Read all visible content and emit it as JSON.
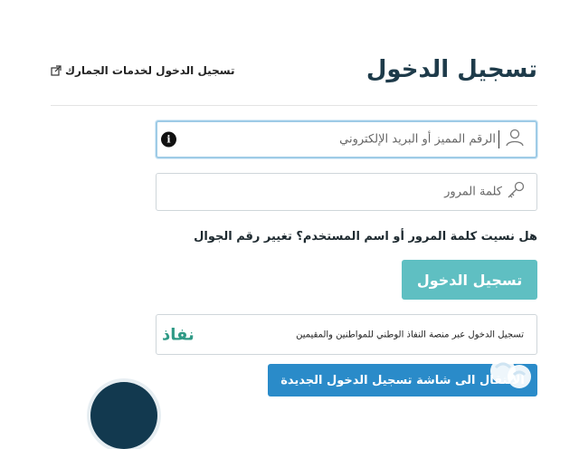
{
  "header": {
    "title": "تسجيل الدخول",
    "customs_link": "تسجيل الدخول لخدمات الجمارك"
  },
  "form": {
    "username_placeholder": "الرقم المميز أو البريد الإلكتروني",
    "password_placeholder": "كلمة المرور",
    "forgot_text": "هل نسيت كلمة المرور أو اسم المستخدم؟ تغيير رقم الجوال",
    "login_button": "تسجيل الدخول"
  },
  "nafath": {
    "text": "تسجيل الدخول عبر منصة النفاذ الوطني للمواطنين والمقيمين",
    "logo": "نفاذ"
  },
  "new_login_button": "الانتقال الى شاشة تسجيل الدخول الجديدة",
  "colors": {
    "title": "#1e3b4a",
    "login_button": "#5fbfc2",
    "new_login_button": "#2a8bc9",
    "nafath_logo": "#2f9a86",
    "accent_circle": "#12394f"
  },
  "icons": {
    "customs_link": "external-link-icon",
    "username": "user-icon",
    "password": "key-icon",
    "info": "info-icon",
    "floating": "chat-icon"
  }
}
